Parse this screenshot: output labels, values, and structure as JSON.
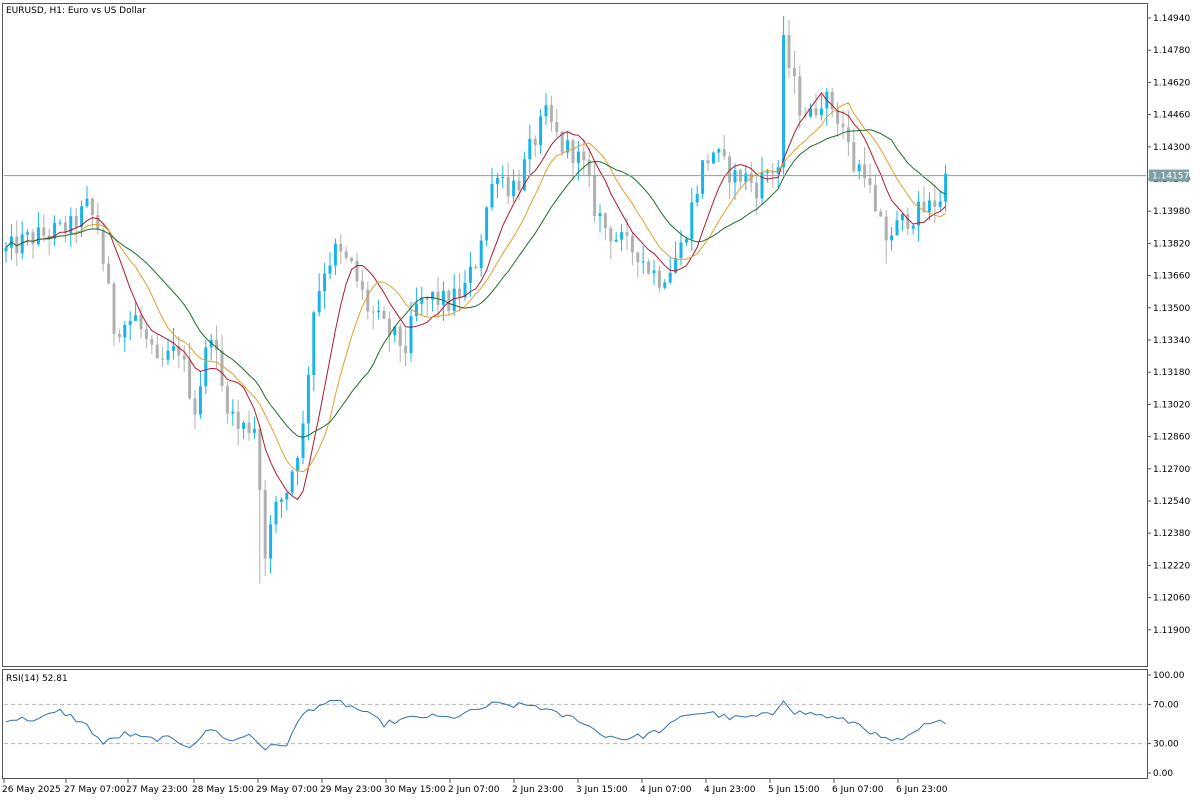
{
  "header": {
    "symbol_title": "EURUSD, H1:  Euro vs US Dollar"
  },
  "rsi_panel": {
    "label": "RSI(14) 52.81",
    "levels": [
      70,
      30
    ],
    "ticks": [
      "100.00",
      "70.00",
      "30.00",
      "0.00"
    ]
  },
  "current_price": {
    "value": 1.14157,
    "label": "1.14157"
  },
  "colors": {
    "bull_candle": "#1ab3e6",
    "bear_candle": "#b0b0b0",
    "ma_fast": "#b0192c",
    "ma_mid": "#e0a030",
    "ma_slow": "#1f6b2a",
    "rsi_line": "#2f6fb0",
    "price_line": "#7f9fa6",
    "price_tag_bg": "#7f9fa6"
  },
  "chart_data": [
    {
      "type": "candlestick",
      "title": "EURUSD, H1:  Euro vs US Dollar",
      "ylim": [
        1.118,
        1.1502
      ],
      "y_ticks": [
        "1.14940",
        "1.14780",
        "1.14620",
        "1.14460",
        "1.14300",
        "1.14140",
        "1.13980",
        "1.13820",
        "1.13660",
        "1.13500",
        "1.13340",
        "1.13180",
        "1.13020",
        "1.12860",
        "1.12700",
        "1.12540",
        "1.12380",
        "1.12220",
        "1.12060",
        "1.11900"
      ],
      "x_ticks": [
        "26 May 2025",
        "27 May 07:00",
        "27 May 23:00",
        "28 May 15:00",
        "29 May 07:00",
        "29 May 23:00",
        "30 May 15:00",
        "2 Jun 07:00",
        "2 Jun 23:00",
        "3 Jun 15:00",
        "4 Jun 07:00",
        "4 Jun 23:00",
        "5 Jun 15:00",
        "6 Jun 07:00",
        "6 Jun 23:00"
      ],
      "grid": false,
      "price_path": [
        [
          0,
          1.1378
        ],
        [
          4,
          1.1384
        ],
        [
          8,
          1.1387
        ],
        [
          12,
          1.139
        ],
        [
          15,
          1.14
        ],
        [
          17,
          1.139
        ],
        [
          20,
          1.134
        ],
        [
          24,
          1.1345
        ],
        [
          28,
          1.132
        ],
        [
          32,
          1.133
        ],
        [
          35,
          1.13
        ],
        [
          38,
          1.134
        ],
        [
          40,
          1.131
        ],
        [
          43,
          1.129
        ],
        [
          46,
          1.1292
        ],
        [
          48,
          1.123
        ],
        [
          50,
          1.125
        ],
        [
          52,
          1.126
        ],
        [
          54,
          1.128
        ],
        [
          55,
          1.129
        ],
        [
          57,
          1.135
        ],
        [
          59,
          1.137
        ],
        [
          61,
          1.1378
        ],
        [
          64,
          1.137
        ],
        [
          67,
          1.135
        ],
        [
          70,
          1.134
        ],
        [
          72,
          1.1335
        ],
        [
          74,
          1.133
        ],
        [
          76,
          1.135
        ],
        [
          79,
          1.1355
        ],
        [
          82,
          1.1352
        ],
        [
          85,
          1.136
        ],
        [
          87,
          1.1373
        ],
        [
          89,
          1.14
        ],
        [
          91,
          1.142
        ],
        [
          93,
          1.141
        ],
        [
          95,
          1.1413
        ],
        [
          97,
          1.1428
        ],
        [
          99,
          1.144
        ],
        [
          100,
          1.1445
        ],
        [
          101,
          1.144
        ],
        [
          103,
          1.143
        ],
        [
          105,
          1.1428
        ],
        [
          107,
          1.142
        ],
        [
          109,
          1.14
        ],
        [
          111,
          1.139
        ],
        [
          113,
          1.1385
        ],
        [
          115,
          1.138
        ],
        [
          117,
          1.1378
        ],
        [
          119,
          1.137
        ],
        [
          121,
          1.1365
        ],
        [
          123,
          1.137
        ],
        [
          125,
          1.138
        ],
        [
          127,
          1.14
        ],
        [
          129,
          1.142
        ],
        [
          131,
          1.1428
        ],
        [
          133,
          1.142
        ],
        [
          135,
          1.1415
        ],
        [
          137,
          1.1415
        ],
        [
          139,
          1.141
        ],
        [
          141,
          1.1418
        ],
        [
          143,
          1.142
        ],
        [
          144,
          1.148
        ],
        [
          145,
          1.147
        ],
        [
          147,
          1.145
        ],
        [
          149,
          1.1445
        ],
        [
          151,
          1.1455
        ],
        [
          153,
          1.145
        ],
        [
          155,
          1.144
        ],
        [
          157,
          1.142
        ],
        [
          159,
          1.142
        ],
        [
          161,
          1.1395
        ],
        [
          163,
          1.1385
        ],
        [
          165,
          1.139
        ],
        [
          167,
          1.1395
        ],
        [
          169,
          1.1397
        ],
        [
          171,
          1.14
        ],
        [
          173,
          1.1405
        ],
        [
          174,
          1.1415
        ]
      ],
      "rsi_path": [
        [
          0,
          55
        ],
        [
          6,
          55
        ],
        [
          10,
          63
        ],
        [
          12,
          58
        ],
        [
          15,
          48
        ],
        [
          18,
          30
        ],
        [
          22,
          40
        ],
        [
          26,
          35
        ],
        [
          30,
          35
        ],
        [
          34,
          28
        ],
        [
          38,
          45
        ],
        [
          42,
          32
        ],
        [
          45,
          40
        ],
        [
          48,
          25
        ],
        [
          52,
          30
        ],
        [
          55,
          60
        ],
        [
          58,
          70
        ],
        [
          62,
          72
        ],
        [
          66,
          63
        ],
        [
          70,
          50
        ],
        [
          74,
          55
        ],
        [
          78,
          58
        ],
        [
          82,
          56
        ],
        [
          86,
          62
        ],
        [
          90,
          70
        ],
        [
          94,
          69
        ],
        [
          98,
          69
        ],
        [
          102,
          60
        ],
        [
          106,
          55
        ],
        [
          110,
          40
        ],
        [
          114,
          35
        ],
        [
          118,
          38
        ],
        [
          122,
          45
        ],
        [
          126,
          60
        ],
        [
          130,
          62
        ],
        [
          134,
          56
        ],
        [
          138,
          57
        ],
        [
          142,
          60
        ],
        [
          144,
          76
        ],
        [
          146,
          62
        ],
        [
          150,
          60
        ],
        [
          154,
          55
        ],
        [
          158,
          50
        ],
        [
          162,
          35
        ],
        [
          166,
          32
        ],
        [
          170,
          48
        ],
        [
          174,
          53
        ]
      ]
    }
  ]
}
